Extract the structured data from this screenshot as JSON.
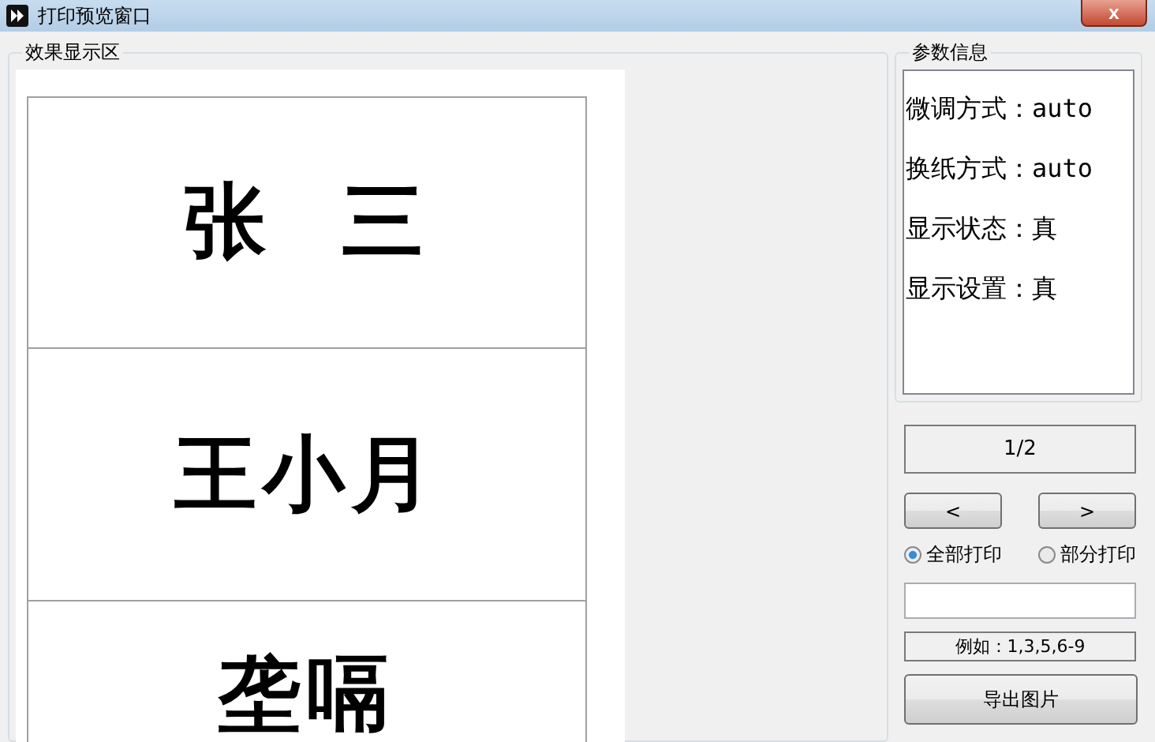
{
  "window": {
    "title": "打印预览窗口",
    "close": "x"
  },
  "preview": {
    "legend": "效果显示区",
    "cards": [
      {
        "name": "张  三"
      },
      {
        "name": "王小月"
      },
      {
        "name": "垄嗝"
      }
    ]
  },
  "params": {
    "legend": "参数信息",
    "lines": [
      "微调方式：auto",
      "换纸方式：auto",
      "显示状态：真",
      "显示设置：真"
    ]
  },
  "pager": {
    "page": "1/2",
    "prev": "<",
    "next": ">"
  },
  "print_mode": [
    {
      "label": "全部打印",
      "selected": true
    },
    {
      "label": "部分打印",
      "selected": false
    }
  ],
  "example": "例如：1,3,5,6-9",
  "export_button": "导出图片"
}
